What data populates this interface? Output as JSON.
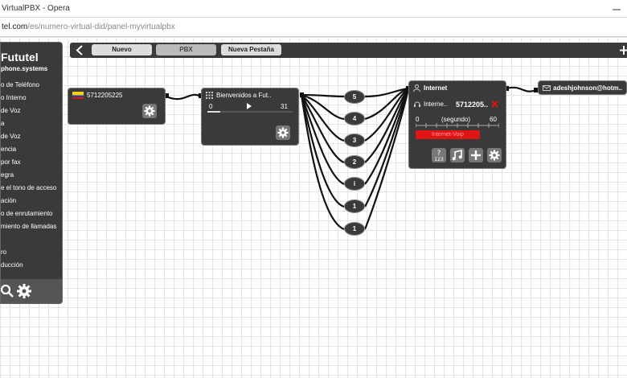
{
  "window": {
    "title": "VirtualPBX - Opera"
  },
  "address": {
    "host": "tel.com",
    "path": "/es/numero-virtual-did/panel-myvirtualpbx"
  },
  "sidebar": {
    "brand": "Fututel",
    "domain": "phone.systems",
    "items": [
      {
        "label": "o de Teléfono"
      },
      {
        "label": "o Interno"
      },
      {
        "label": "de Voz"
      },
      {
        "label": "a"
      },
      {
        "label": " de Voz"
      },
      {
        "label": "encia"
      },
      {
        "label": "por fax"
      },
      {
        "label": "egra"
      },
      {
        "label": "e el tono de acceso"
      },
      {
        "label": "ación"
      },
      {
        "label": "o de enrutamiento"
      },
      {
        "label": "miento de llamadas"
      },
      {
        "label": "ro"
      },
      {
        "label": "ducción"
      }
    ],
    "icons": [
      "search-icon",
      "gear-icon"
    ]
  },
  "tabs": [
    {
      "label": "Nuevo"
    },
    {
      "label": "PBX",
      "active": true
    },
    {
      "label": "Nueva Pestaña"
    }
  ],
  "nodes": {
    "did": {
      "number": "5712205225"
    },
    "ivr": {
      "title": "Bienvenidos a Fut..",
      "min": "0",
      "max": "31",
      "progress": 0.15
    },
    "internet": {
      "title": "Internet",
      "sub": "Interne..",
      "number": "5712205..",
      "min": "0",
      "unit": "(segundo)",
      "max": "60",
      "badge": "Internet-Voip"
    },
    "email": {
      "address": "adeshjohnson@hotm.."
    }
  },
  "options": [
    {
      "label": "5"
    },
    {
      "label": "4"
    },
    {
      "label": "3"
    },
    {
      "label": "2"
    },
    {
      "label": "i"
    },
    {
      "label": "1"
    },
    {
      "label": "1"
    }
  ],
  "colors": {
    "panel": "#3a3a3a",
    "badge": "#e01414",
    "grid": "#e4e4e4"
  }
}
